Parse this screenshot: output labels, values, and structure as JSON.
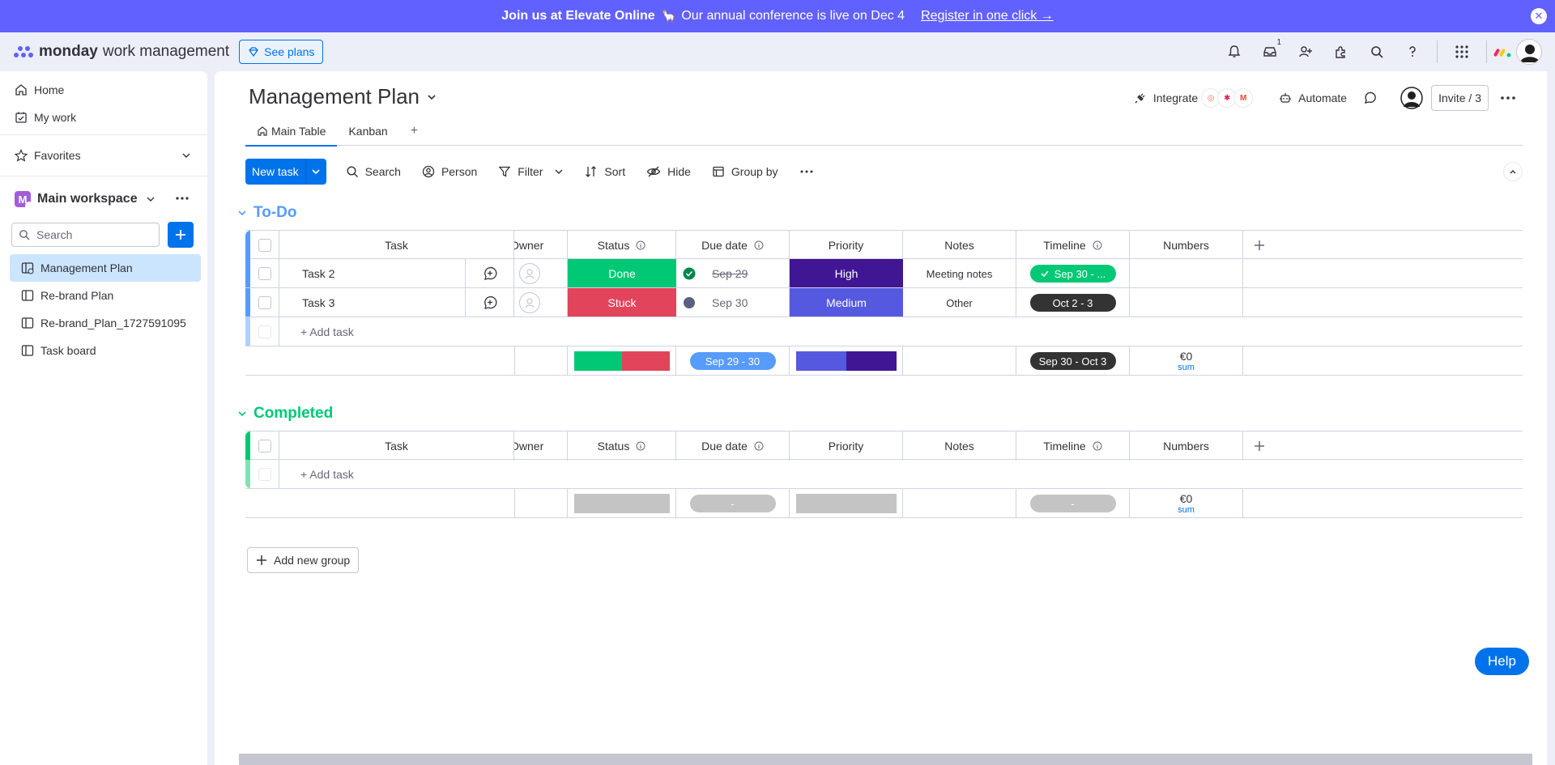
{
  "banner": {
    "bold": "Join us at Elevate Online",
    "text": "Our annual conference is live on Dec 4",
    "link": "Register in one click →"
  },
  "topbar": {
    "brand": "monday",
    "product": "work management",
    "see_plans": "See plans",
    "inbox_badge": "1"
  },
  "sidebar": {
    "home": "Home",
    "my_work": "My work",
    "favorites": "Favorites",
    "workspace_initial": "M",
    "workspace": "Main workspace",
    "search_placeholder": "Search",
    "boards": [
      {
        "label": "Management Plan"
      },
      {
        "label": "Re-brand Plan"
      },
      {
        "label": "Re-brand_Plan_1727591095"
      },
      {
        "label": "Task board"
      }
    ]
  },
  "board": {
    "title": "Management Plan",
    "integrate": "Integrate",
    "automate": "Automate",
    "invite": "Invite / 3",
    "tabs": [
      {
        "label": "Main Table"
      },
      {
        "label": "Kanban"
      }
    ],
    "add_tab": "+"
  },
  "toolbar": {
    "new_task": "New task",
    "search": "Search",
    "person": "Person",
    "filter": "Filter",
    "sort": "Sort",
    "hide": "Hide",
    "group_by": "Group by"
  },
  "columns": {
    "task": "Task",
    "owner": "Owner",
    "status": "Status",
    "due_date": "Due date",
    "priority": "Priority",
    "notes": "Notes",
    "timeline": "Timeline",
    "numbers": "Numbers"
  },
  "groups": [
    {
      "title": "To-Do",
      "color": "#579bfc",
      "rows": [
        {
          "task": "Task 2",
          "status": "Done",
          "status_color": "#00c875",
          "due": "Sep 29",
          "priority": "High",
          "priority_color": "#401694",
          "notes": "Meeting notes",
          "timeline": "Sep 30 - ...",
          "timeline_color": "#00c875"
        },
        {
          "task": "Task 3",
          "status": "Stuck",
          "status_color": "#e2445c",
          "due": "Sep 30",
          "priority": "Medium",
          "priority_color": "#5559df",
          "notes": "Other",
          "timeline": "Oct 2 - 3",
          "timeline_color": "#333333"
        }
      ],
      "add_task": "+ Add task",
      "summary": {
        "due": "Sep 29 - 30",
        "timeline": "Sep 30 - Oct 3",
        "numbers": "€0",
        "numbers_label": "sum"
      }
    },
    {
      "title": "Completed",
      "color": "#00c875",
      "add_task": "+ Add task",
      "summary": {
        "due": "-",
        "timeline": "-",
        "numbers": "€0",
        "numbers_label": "sum"
      }
    }
  ],
  "add_group": "Add new group",
  "help": "Help",
  "colors": {
    "primary": "#0073ea",
    "banner": "#6161ff",
    "done": "#00c875",
    "stuck": "#e2445c",
    "high": "#401694",
    "medium": "#5559df",
    "due_summary": "#579bfc"
  }
}
